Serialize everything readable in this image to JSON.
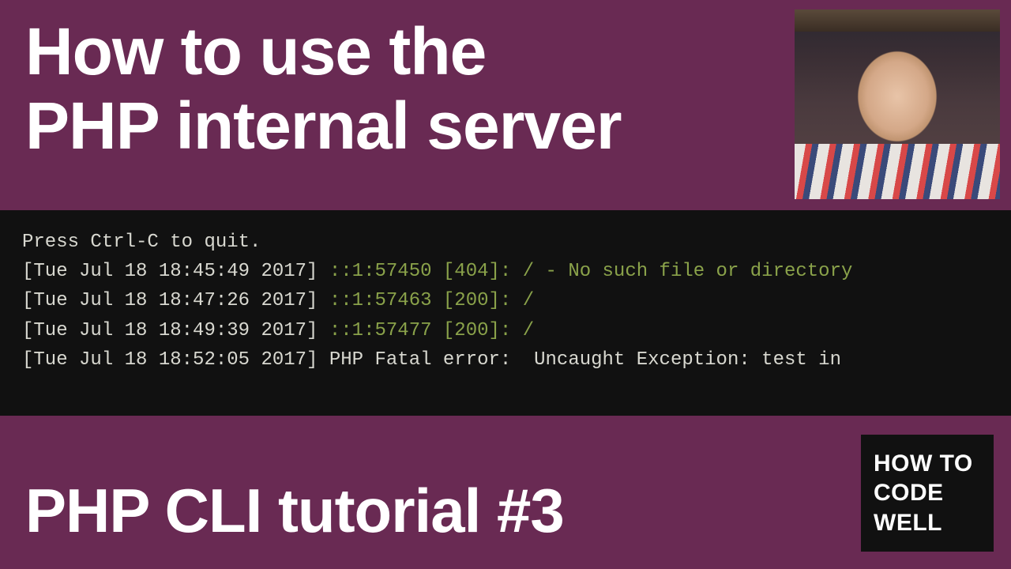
{
  "title": {
    "line1": "How to use the",
    "line2": "PHP internal server"
  },
  "terminal": {
    "instruction": "Press Ctrl-C to quit.",
    "logs": [
      {
        "ts": "[Tue Jul 18 18:45:49 2017] ",
        "green": "::1:57450 [404]: / - No such file or directory",
        "tail": ""
      },
      {
        "ts": "[Tue Jul 18 18:47:26 2017] ",
        "green": "::1:57463 [200]: /",
        "tail": ""
      },
      {
        "ts": "[Tue Jul 18 18:49:39 2017] ",
        "green": "::1:57477 [200]: /",
        "tail": ""
      },
      {
        "ts": "[Tue Jul 18 18:52:05 2017] ",
        "green": "",
        "tail": "PHP Fatal error:  Uncaught Exception: test in"
      }
    ]
  },
  "subtitle": "PHP CLI tutorial #3",
  "badge": {
    "line1": "HOW TO",
    "line2": "CODE",
    "line3": "WELL"
  }
}
